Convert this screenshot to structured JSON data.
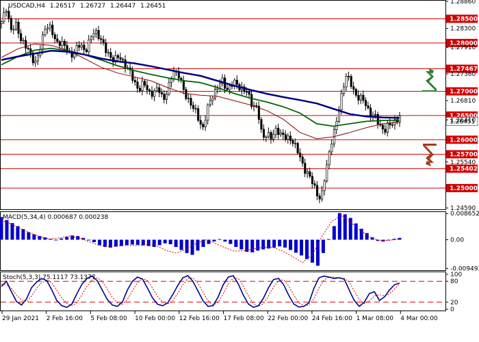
{
  "header": {
    "symbol": "USDCAD,H4",
    "open": "1.26517",
    "high": "1.26727",
    "low": "1.26447",
    "close": "1.26451"
  },
  "colors": {
    "level": "#d40000",
    "ma_blue": "#000080",
    "ma_green": "#006400",
    "ma_dark_red": "#8b0000",
    "candle": "#000000",
    "macd_bar": "#0000cd",
    "signal": "#d40000",
    "stoch_main": "#00008b",
    "stoch_signal": "#d40000",
    "arrow_up": "#2e7d32",
    "arrow_down": "#a23b1b",
    "grid": "#c0c0c0"
  },
  "chart_data": [
    {
      "type": "candlestick",
      "panel": "price",
      "ylim": [
        1.2459,
        1.2886
      ],
      "y_ticks": [
        "1.28860",
        "1.28300",
        "1.27910",
        "1.27360",
        "1.26810",
        "1.26410",
        "1.25540",
        "1.24590"
      ],
      "level_labels": [
        "1.28500",
        "1.28000",
        "1.27467",
        "1.27000",
        "1.26500",
        "1.26000",
        "1.25700",
        "1.25402",
        "1.25000"
      ],
      "levels": [
        1.285,
        1.28,
        1.27467,
        1.27,
        1.265,
        1.26,
        1.257,
        1.25402,
        1.25
      ],
      "price_tag": "1.26451",
      "close_path": [
        1.284,
        1.2875,
        1.2825,
        1.2835,
        1.281,
        1.279,
        1.2775,
        1.276,
        1.279,
        1.284,
        1.283,
        1.28,
        1.2805,
        1.279,
        1.2775,
        1.2785,
        1.2795,
        1.2785,
        1.2805,
        1.2825,
        1.2815,
        1.2785,
        1.2775,
        1.2765,
        1.277,
        1.276,
        1.274,
        1.272,
        1.2705,
        1.2715,
        1.27,
        1.2695,
        1.2705,
        1.2685,
        1.2705,
        1.2745,
        1.2735,
        1.27,
        1.2685,
        1.2665,
        1.2645,
        1.2625,
        1.2665,
        1.2695,
        1.271,
        1.272,
        1.2705,
        1.2715,
        1.2715,
        1.2705,
        1.2695,
        1.2675,
        1.2665,
        1.2605,
        1.2615,
        1.26,
        1.2625,
        1.261,
        1.26,
        1.2605,
        1.258,
        1.2555,
        1.2535,
        1.2515,
        1.2495,
        1.2475,
        1.2535,
        1.2595,
        1.2625,
        1.2685,
        1.2735,
        1.2715,
        1.2695,
        1.2685,
        1.2675,
        1.2655,
        1.2645,
        1.263,
        1.262,
        1.263,
        1.264,
        1.2645
      ],
      "ma_blue": [
        1.2765,
        1.2772,
        1.2778,
        1.2784,
        1.2782,
        1.2776,
        1.2768,
        1.2762,
        1.2758,
        1.2752,
        1.2745,
        1.2738,
        1.2732,
        1.2722,
        1.2712,
        1.2703,
        1.2695,
        1.2688,
        1.2682,
        1.2675,
        1.2664,
        1.2653,
        1.2648,
        1.2646,
        1.2645
      ],
      "ma_green": [
        1.2755,
        1.2772,
        1.2785,
        1.2789,
        1.2784,
        1.2776,
        1.2765,
        1.2753,
        1.2743,
        1.2735,
        1.2728,
        1.2722,
        1.2718,
        1.2708,
        1.2696,
        1.2686,
        1.2678,
        1.2668,
        1.2655,
        1.2633,
        1.2628,
        1.2633,
        1.2638,
        1.264,
        1.264
      ],
      "ma_dark_red": [
        1.277,
        1.2788,
        1.2798,
        1.2795,
        1.2785,
        1.2768,
        1.275,
        1.2738,
        1.273,
        1.2722,
        1.2708,
        1.2696,
        1.2692,
        1.269,
        1.2681,
        1.2672,
        1.266,
        1.2642,
        1.2615,
        1.2602,
        1.2606,
        1.2615,
        1.2625,
        1.2633,
        1.2637
      ]
    },
    {
      "type": "bar",
      "panel": "macd",
      "title": "MACD(5,34,4) 0.000687 0.000238",
      "ylim": [
        -0.0094,
        0.0087
      ],
      "y_ticks": [
        "0.008652",
        "0.00",
        "-0.009492"
      ],
      "values": [
        0.0075,
        0.0065,
        0.0055,
        0.0045,
        0.0035,
        0.0025,
        0.0018,
        0.0012,
        0.0008,
        0.0003,
        -0.0002,
        0.0004,
        0.0009,
        0.0014,
        0.0012,
        0.0006,
        0.0,
        -0.0008,
        -0.0018,
        -0.0024,
        -0.0026,
        -0.0023,
        -0.0021,
        -0.0018,
        -0.0016,
        -0.0017,
        -0.0019,
        -0.0021,
        -0.0024,
        -0.0018,
        -0.0012,
        -0.0015,
        -0.0024,
        -0.0034,
        -0.0044,
        -0.005,
        -0.0036,
        -0.0024,
        -0.0014,
        -0.0006,
        0.0002,
        -0.0006,
        -0.0014,
        -0.0024,
        -0.0032,
        -0.004,
        -0.0042,
        -0.0036,
        -0.0032,
        -0.0029,
        -0.0026,
        -0.0022,
        -0.0026,
        -0.0034,
        -0.0043,
        -0.0052,
        -0.0064,
        -0.0076,
        -0.0086,
        -0.0044,
        0.0002,
        0.0045,
        0.0088,
        0.0084,
        0.0072,
        0.0054,
        0.0036,
        0.0022,
        0.0008,
        -0.0004,
        -0.0006,
        -0.0002,
        0.0003,
        0.0006
      ],
      "signal": [
        0.0065,
        0.0052,
        0.0037,
        0.0022,
        0.001,
        0.0002,
        0.0006,
        0.0012,
        0.0006,
        -0.0006,
        -0.0018,
        -0.0022,
        -0.002,
        -0.0018,
        -0.002,
        -0.0016,
        -0.002,
        -0.0036,
        -0.0044,
        -0.0032,
        -0.0014,
        0.0,
        -0.0012,
        -0.0026,
        -0.0038,
        -0.0036,
        -0.003,
        -0.0025,
        -0.0026,
        -0.0038,
        -0.0056,
        -0.0076,
        -0.005,
        0.001,
        0.006,
        0.008,
        0.0056,
        0.003,
        0.0008,
        -0.0004,
        -0.0002,
        0.0002
      ]
    },
    {
      "type": "line",
      "panel": "stoch",
      "title": "Stoch(5,3,3) 75.1117 73.1377",
      "ylim": [
        0,
        100
      ],
      "y_ticks": [
        "100",
        "80",
        "20",
        "0"
      ],
      "levels": [
        80,
        20
      ],
      "main": [
        65,
        80,
        50,
        22,
        12,
        30,
        62,
        78,
        88,
        82,
        55,
        25,
        10,
        5,
        15,
        45,
        72,
        88,
        95,
        82,
        55,
        28,
        12,
        8,
        20,
        55,
        80,
        92,
        86,
        60,
        32,
        14,
        10,
        18,
        42,
        68,
        90,
        96,
        80,
        52,
        24,
        8,
        10,
        35,
        70,
        92,
        96,
        72,
        40,
        15,
        5,
        10,
        32,
        62,
        85,
        88,
        70,
        40,
        15,
        6,
        8,
        18,
        60,
        90,
        95,
        92,
        88,
        90,
        86,
        55,
        25,
        8,
        20,
        45,
        50,
        25,
        35,
        55,
        70,
        75
      ],
      "signal": [
        72,
        70,
        60,
        40,
        26,
        22,
        38,
        60,
        76,
        84,
        76,
        54,
        32,
        16,
        10,
        18,
        42,
        66,
        84,
        90,
        80,
        58,
        34,
        18,
        14,
        28,
        52,
        76,
        88,
        82,
        60,
        36,
        20,
        15,
        24,
        46,
        70,
        88,
        90,
        74,
        48,
        24,
        12,
        20,
        44,
        72,
        90,
        88,
        66,
        38,
        16,
        8,
        16,
        38,
        64,
        82,
        84,
        66,
        40,
        18,
        10,
        12,
        30,
        60,
        84,
        92,
        92,
        90,
        88,
        78,
        52,
        28,
        16,
        24,
        38,
        42,
        38,
        44,
        58,
        73
      ]
    }
  ],
  "x_axis": {
    "labels": [
      "29 Jan 2021",
      "2 Feb 16:00",
      "5 Feb 08:00",
      "10 Feb 00:00",
      "12 Feb 16:00",
      "17 Feb 08:00",
      "22 Feb 00:00",
      "24 Feb 16:00",
      "1 Mar 08:00",
      "4 Mar 00:00"
    ]
  }
}
